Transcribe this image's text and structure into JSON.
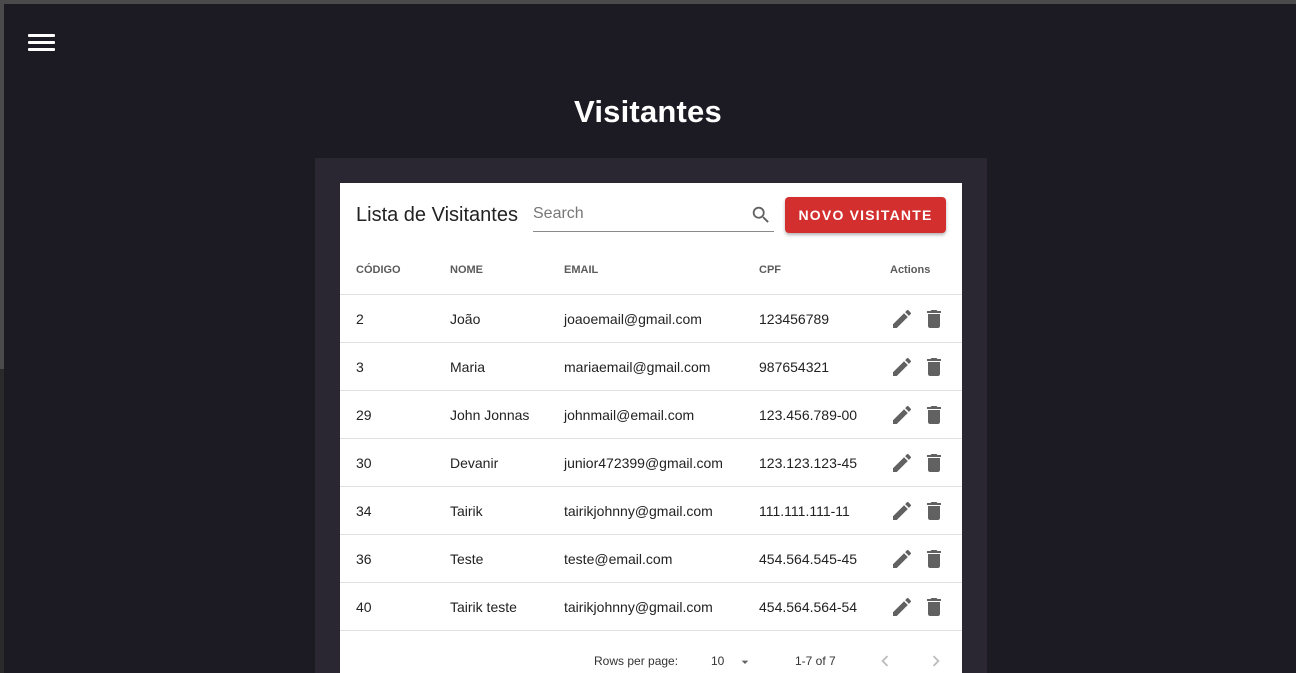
{
  "page": {
    "title": "Visitantes"
  },
  "toolbar": {
    "title": "Lista de Visitantes",
    "search_placeholder": "Search",
    "new_button": "NOVO VISITANTE"
  },
  "table": {
    "headers": {
      "codigo": "CÓDIGO",
      "nome": "NOME",
      "email": "EMAIL",
      "cpf": "CPF",
      "actions": "Actions"
    },
    "rows": [
      {
        "codigo": "2",
        "nome": "João",
        "email": "joaoemail@gmail.com",
        "cpf": "123456789"
      },
      {
        "codigo": "3",
        "nome": "Maria",
        "email": "mariaemail@gmail.com",
        "cpf": "987654321"
      },
      {
        "codigo": "29",
        "nome": "John Jonnas",
        "email": "johnmail@email.com",
        "cpf": "123.456.789-00"
      },
      {
        "codigo": "30",
        "nome": "Devanir",
        "email": "junior472399@gmail.com",
        "cpf": "123.123.123-45"
      },
      {
        "codigo": "34",
        "nome": "Tairik",
        "email": "tairikjohnny@gmail.com",
        "cpf": "111.111.111-11"
      },
      {
        "codigo": "36",
        "nome": "Teste",
        "email": "teste@email.com",
        "cpf": "454.564.545-45"
      },
      {
        "codigo": "40",
        "nome": "Tairik teste",
        "email": "tairikjohnny@gmail.com",
        "cpf": "454.564.564-54"
      }
    ]
  },
  "pagination": {
    "rows_per_page_label": "Rows per page:",
    "rows_per_page_value": "10",
    "range": "1-7 of 7"
  },
  "icons": {
    "menu": "menu-icon",
    "search": "search-icon",
    "edit": "pencil-icon",
    "delete": "trash-icon",
    "dropdown": "caret-down-icon",
    "prev": "chevron-left-icon",
    "next": "chevron-right-icon"
  },
  "colors": {
    "background": "#1c1a22",
    "panel": "#2a2733",
    "accent": "#d32f2f",
    "icon": "#616161"
  }
}
